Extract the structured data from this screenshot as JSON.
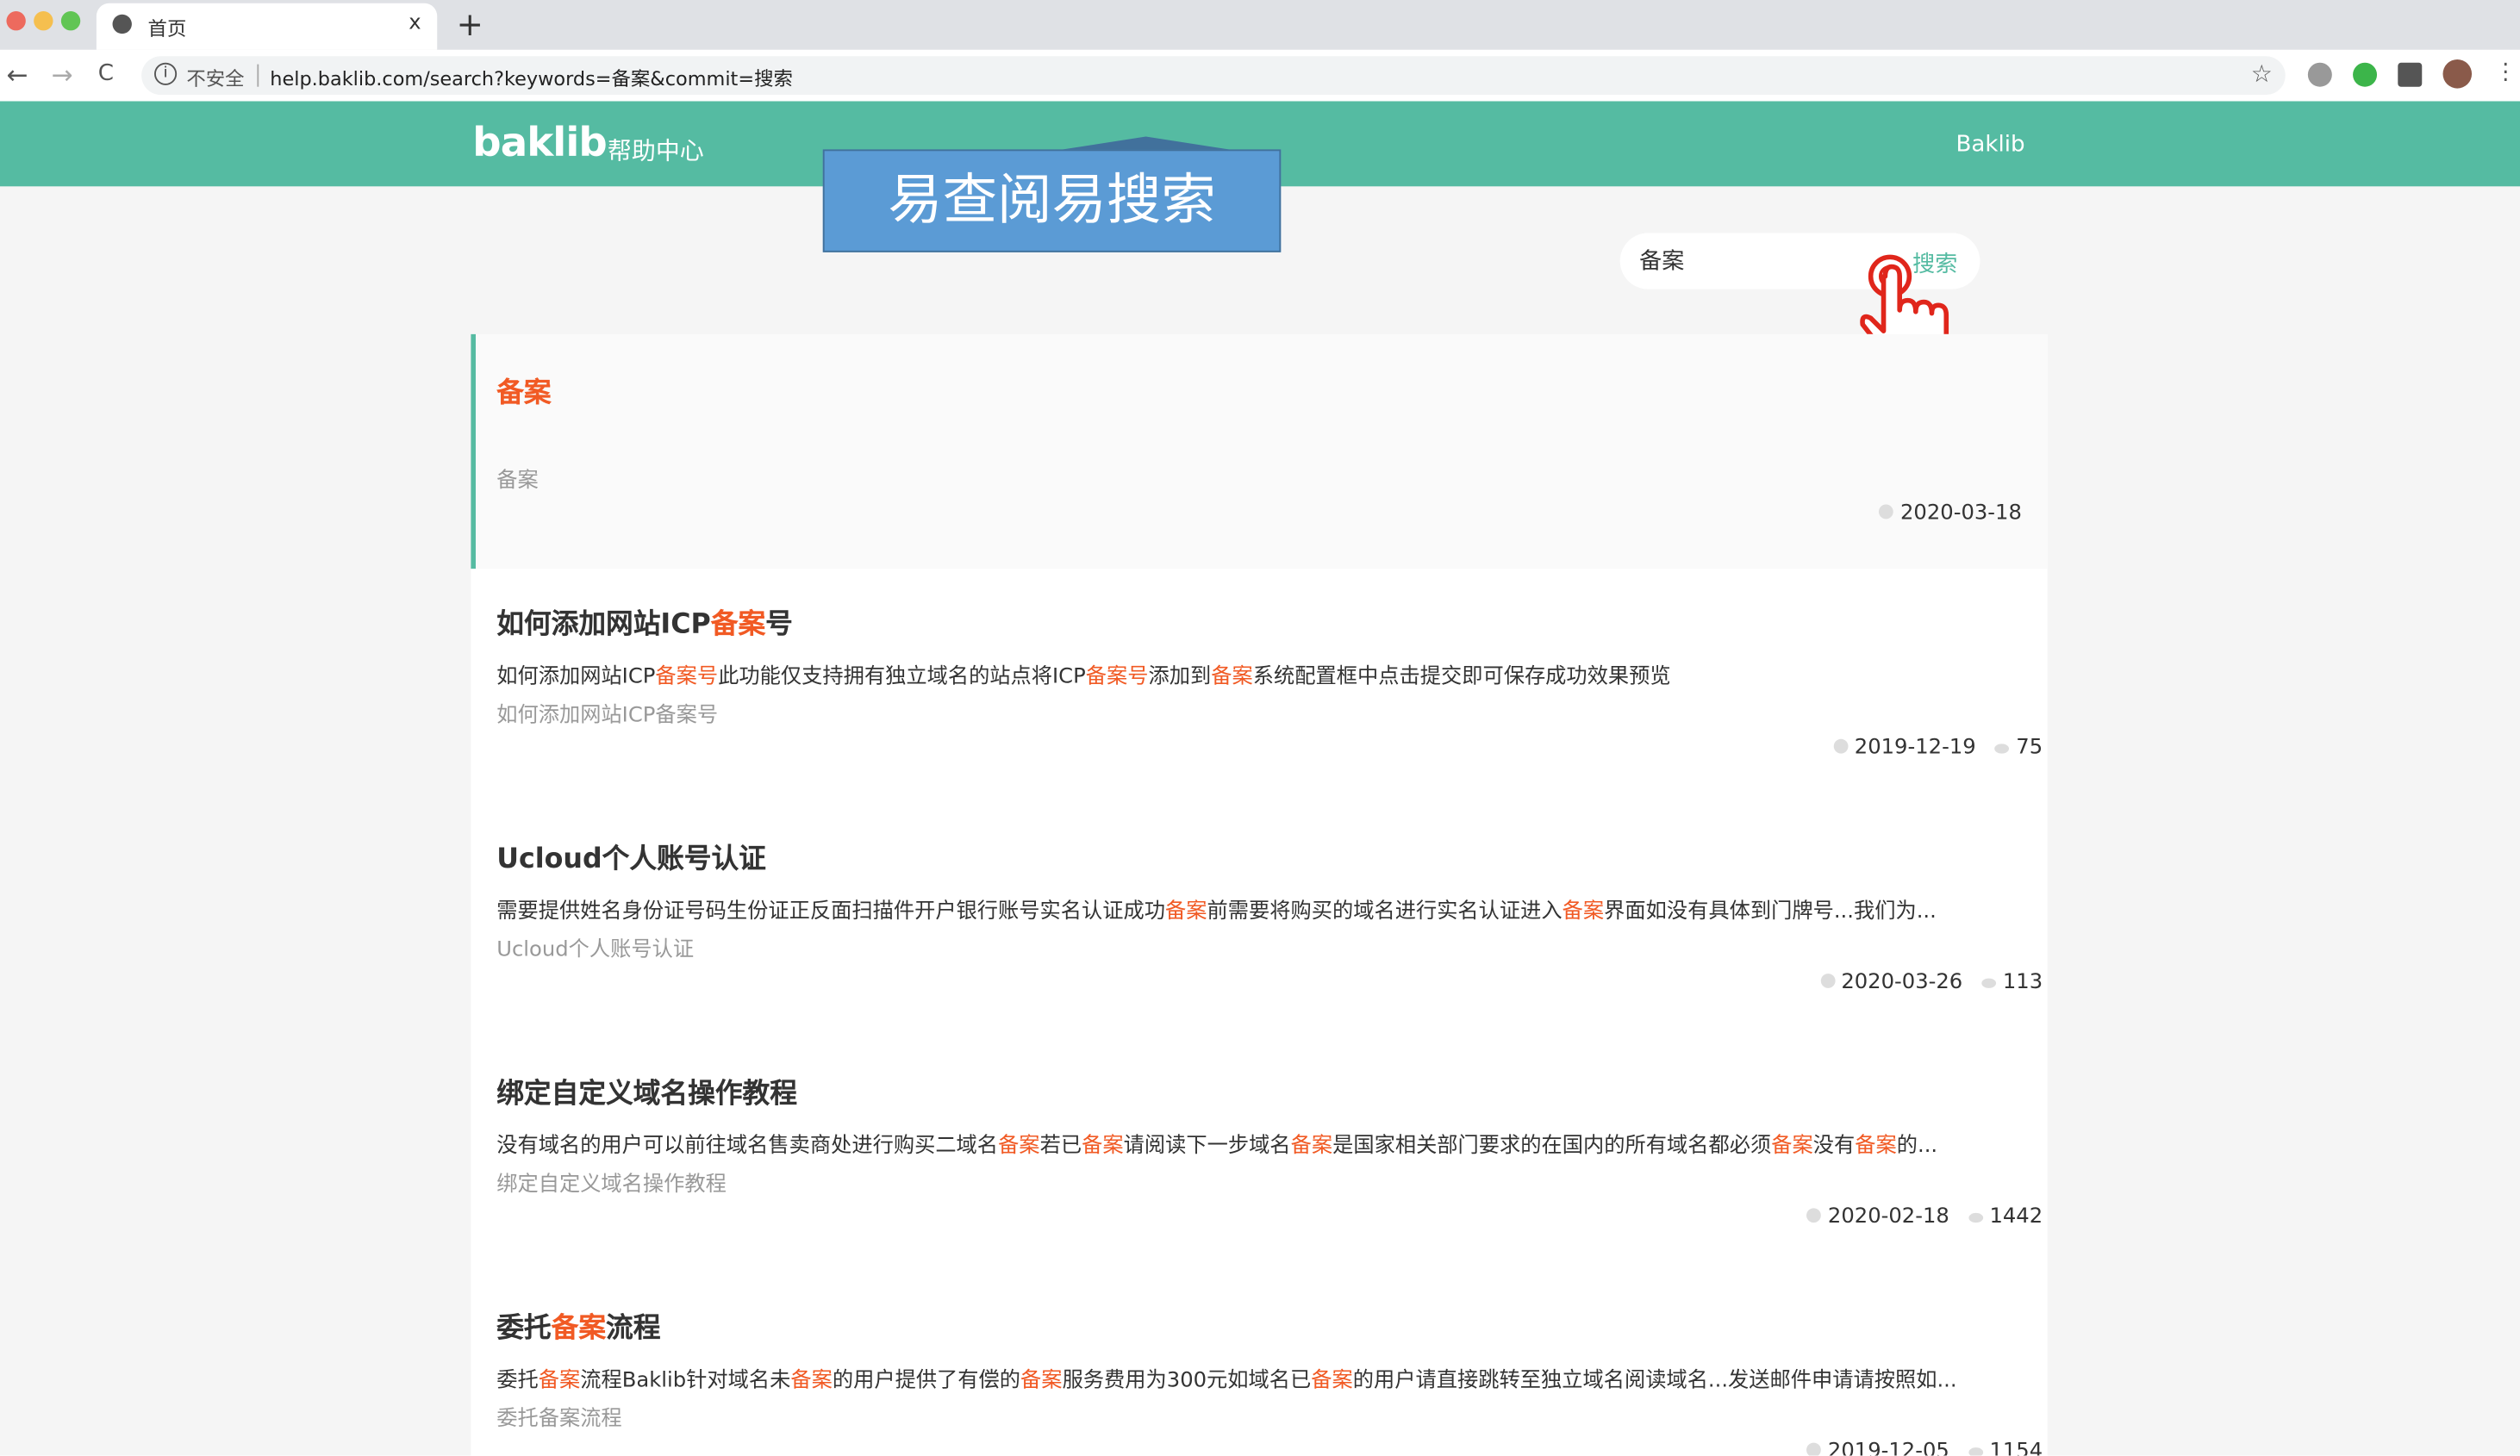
{
  "browser": {
    "tab_title": "首页",
    "close": "x",
    "new_tab": "+",
    "insecure": "不安全",
    "url": "help.baklib.com/search?keywords=备案&commit=搜索",
    "back": "←",
    "forward": "→",
    "reload": "C",
    "star": "☆"
  },
  "header": {
    "logo": "baklib",
    "logo_sub": "帮助中心",
    "link": "Baklib",
    "color": "#55bba2"
  },
  "banner": {
    "text": "易查阅易搜索"
  },
  "search": {
    "value": "备案",
    "button": "搜索"
  },
  "highlight_color": "#f15a24",
  "results": [
    {
      "title": [
        {
          "t": "备案",
          "hl": true
        }
      ],
      "snippet": [],
      "subtitle": "备案",
      "date": "2020-03-18",
      "views": null
    },
    {
      "title": [
        {
          "t": "如何添加网站ICP"
        },
        {
          "t": "备案",
          "hl": true
        },
        {
          "t": "号"
        }
      ],
      "snippet": [
        {
          "t": "如何添加网站ICP"
        },
        {
          "t": "备案号",
          "hl": true
        },
        {
          "t": "此功能仅支持拥有独立域名的站点将ICP"
        },
        {
          "t": "备案号",
          "hl": true
        },
        {
          "t": "添加到"
        },
        {
          "t": "备案",
          "hl": true
        },
        {
          "t": "系统配置框中点击提交即可保存成功效果预览"
        }
      ],
      "subtitle": "如何添加网站ICP备案号",
      "date": "2019-12-19",
      "views": "75"
    },
    {
      "title": [
        {
          "t": "Ucloud个人账号认证"
        }
      ],
      "snippet": [
        {
          "t": "需要提供姓名身份证号码生份证正反面扫描件开户银行账号实名认证成功"
        },
        {
          "t": "备案",
          "hl": true
        },
        {
          "t": "前需要将购买的域名进行实名认证进入"
        },
        {
          "t": "备案",
          "hl": true
        },
        {
          "t": "界面如没有具体到门牌号...我们为..."
        }
      ],
      "subtitle": "Ucloud个人账号认证",
      "date": "2020-03-26",
      "views": "113"
    },
    {
      "title": [
        {
          "t": "绑定自定义域名操作教程"
        }
      ],
      "snippet": [
        {
          "t": "没有域名的用户可以前往域名售卖商处进行购买二域名"
        },
        {
          "t": "备案",
          "hl": true
        },
        {
          "t": "若已"
        },
        {
          "t": "备案",
          "hl": true
        },
        {
          "t": "请阅读下一步域名"
        },
        {
          "t": "备案",
          "hl": true
        },
        {
          "t": "是国家相关部门要求的在国内的所有域名都必须"
        },
        {
          "t": "备案",
          "hl": true
        },
        {
          "t": "没有"
        },
        {
          "t": "备案",
          "hl": true
        },
        {
          "t": "的..."
        }
      ],
      "subtitle": "绑定自定义域名操作教程",
      "date": "2020-02-18",
      "views": "1442"
    },
    {
      "title": [
        {
          "t": "委托"
        },
        {
          "t": "备案",
          "hl": true
        },
        {
          "t": "流程"
        }
      ],
      "snippet": [
        {
          "t": "委托"
        },
        {
          "t": "备案",
          "hl": true
        },
        {
          "t": "流程Baklib针对域名未"
        },
        {
          "t": "备案",
          "hl": true
        },
        {
          "t": "的用户提供了有偿的"
        },
        {
          "t": "备案",
          "hl": true
        },
        {
          "t": "服务费用为300元如域名已"
        },
        {
          "t": "备案",
          "hl": true
        },
        {
          "t": "的用户请直接跳转至独立域名阅读域名...发送邮件申请请按照如..."
        }
      ],
      "subtitle": "委托备案流程",
      "date": "2019-12-05",
      "views": "1154"
    }
  ]
}
